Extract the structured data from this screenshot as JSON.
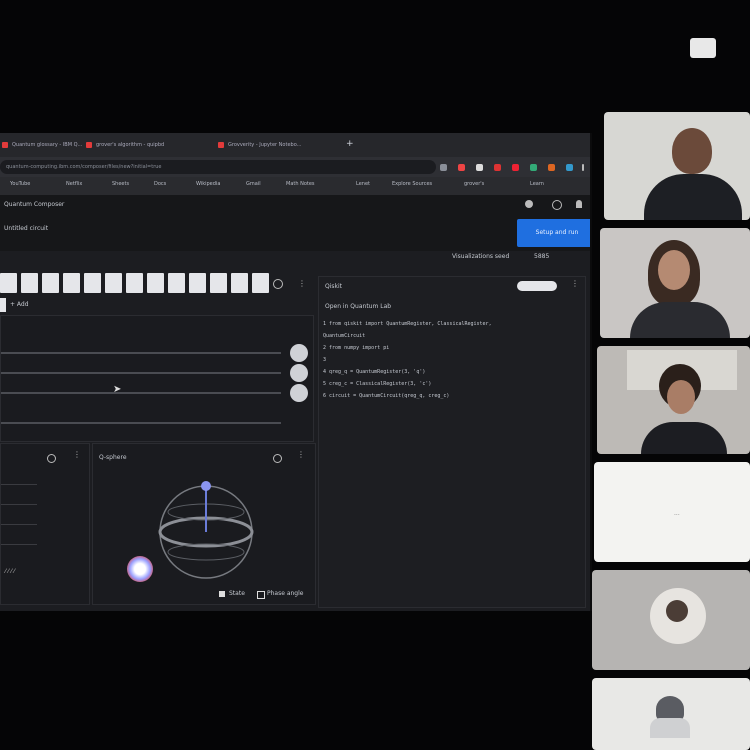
{
  "meeting": {
    "camera_button_icon": "camera-icon"
  },
  "browser": {
    "tabs": [
      "Quantum glossary - IBM Q...",
      "grover's algorithm - quipbd",
      "Grovverity - Jupyter Notebo..."
    ],
    "url": "quantum-computing.ibm.com/composer/files/new?initial=true",
    "bookmarks": [
      "YouTube",
      "Netflix",
      "Sheets",
      "Docs",
      "Wikipedia",
      "Gmail",
      "Math Notes",
      "Lenet",
      "Explore Sources",
      "grover's",
      "Learn"
    ]
  },
  "composer": {
    "title": "Untitled circuit",
    "subtitle": "Quantum Composer",
    "save_label": "Setup and run",
    "visualizations_label": "Visualizations seed",
    "seed_value": "5885",
    "add_label": "+ Add",
    "code_header": "Qiskit",
    "code_subheader": "Open in Quantum Lab",
    "code_lines": [
      "1  from qiskit import QuantumRegister, ClassicalRegister,",
      "   QuantumCircuit",
      "2  from numpy import pi",
      "3",
      "4  qreg_q = QuantumRegister(3, 'q')",
      "5  creg_c = ClassicalRegister(3, 'c')",
      "6  circuit = QuantumCircuit(qreg_q, creg_c)"
    ],
    "qsphere_label": "Q-sphere",
    "state_label": "State",
    "phase_label": "Phase angle"
  },
  "participants": [
    {
      "name": "participant-1"
    },
    {
      "name": "participant-2"
    },
    {
      "name": "participant-3"
    },
    {
      "name": "participant-4",
      "label": "..."
    },
    {
      "name": "participant-5"
    },
    {
      "name": "participant-6"
    }
  ]
}
